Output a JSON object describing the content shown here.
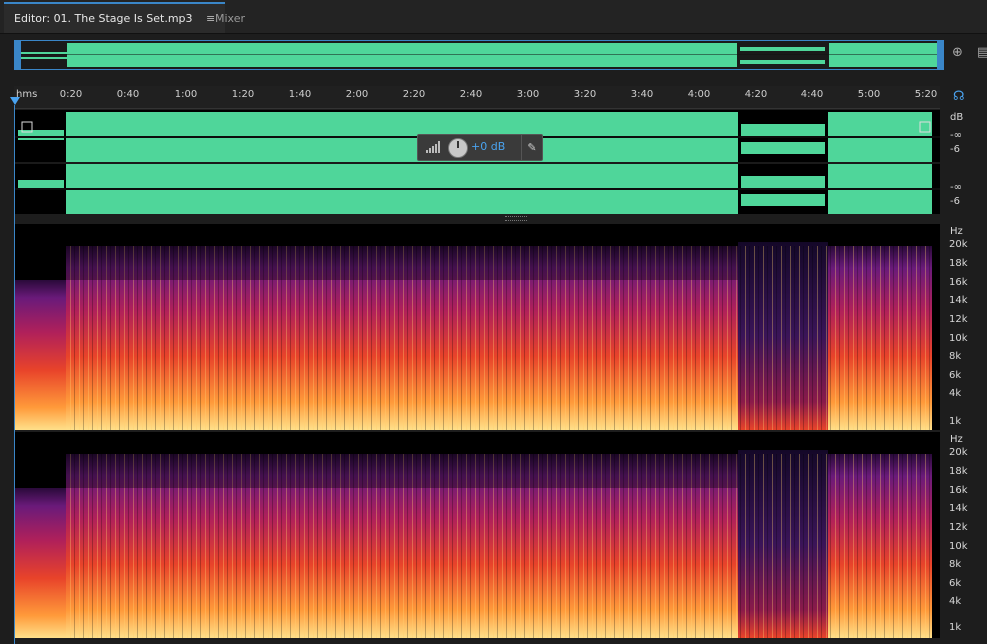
{
  "tabs": [
    {
      "label": "Editor: 01. The Stage Is Set.mp3",
      "active": true,
      "menu_icon": "hamburger-icon"
    },
    {
      "label": "Mixer",
      "active": false
    }
  ],
  "ruler": {
    "unit_label": "hms",
    "ticks": [
      "0:20",
      "0:40",
      "1:00",
      "1:20",
      "1:40",
      "2:00",
      "2:20",
      "2:40",
      "3:00",
      "3:20",
      "3:40",
      "4:00",
      "4:20",
      "4:40",
      "5:00",
      "5:20"
    ]
  },
  "hud": {
    "gain_value": "+0 dB",
    "knob_icon": "volume-knob-icon",
    "pin_icon": "pin-icon"
  },
  "db_scale": {
    "channel1": [
      "dB",
      "-∞",
      "-6"
    ],
    "channel2": [
      "-∞",
      "-6"
    ]
  },
  "spectral_scale": {
    "unit": "Hz",
    "labels": [
      "20k",
      "18k",
      "16k",
      "14k",
      "12k",
      "10k",
      "8k",
      "6k",
      "4k",
      "1k"
    ]
  },
  "colors": {
    "waveform": "#4fd69a",
    "accent": "#3a86c8",
    "spec_low": "#ffe08a",
    "spec_mid": "#e8432a",
    "spec_high": "#6a1a7a"
  }
}
